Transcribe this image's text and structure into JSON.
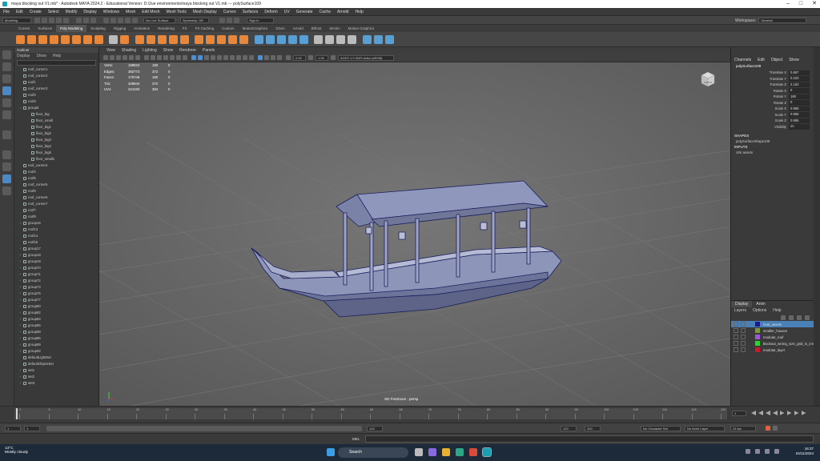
{
  "window": {
    "title": "maya blocking out V1.mb* - Autodesk MAYA 2024.2 - Educational Version: D:\\2ue environments\\maya blocking out V1.mb --- polySurface109"
  },
  "menubar": [
    "File",
    "Edit",
    "Create",
    "Select",
    "Modify",
    "Display",
    "Windows",
    "Mesh",
    "Edit Mesh",
    "Mesh Tools",
    "Mesh Display",
    "Curves",
    "Surfaces",
    "Deform",
    "UV",
    "Generate",
    "Cache",
    "Arnold",
    "Help"
  ],
  "workspace": {
    "label": "Workspace:",
    "value": "General"
  },
  "statusline": {
    "mode": "Modeling",
    "live_surface": "No Live Surface",
    "symmetry": "Symmetry: Off",
    "signin": "Sign In"
  },
  "shelf_tabs": [
    "Curves",
    "Surfaces",
    "Poly Modeling",
    "Sculpting",
    "Rigging",
    "Animation",
    "Rendering",
    "FX",
    "FX Caching",
    "Custom",
    "MotionGraphics",
    "XGen",
    "Arnold",
    "Bifrost",
    "MASH",
    "Motion Graphics"
  ],
  "shelf_active": "Poly Modeling",
  "outliner": {
    "title": "Outliner",
    "menu": [
      "Display",
      "Show",
      "Help"
    ],
    "items": [
      "roof_corner1",
      "roof_corner2",
      "roof1",
      "roof_corner3",
      "roof2",
      "roof3",
      "group5",
      "floor_big",
      "floor_small",
      "floor_big1",
      "floor_big2",
      "floor_big3",
      "floor_big4",
      "floor_big5",
      "floor_small1",
      "roof_corner4",
      "roof4",
      "roof5",
      "roof_corner5",
      "roof6",
      "roof_corner6",
      "roof_corner7",
      "roof7",
      "roof8",
      "group16",
      "roof13",
      "roof14",
      "roof15",
      "group17",
      "group18",
      "group19",
      "group70",
      "group71",
      "group72",
      "group74",
      "group75",
      "group77",
      "group80",
      "group82",
      "group84",
      "group85",
      "group88",
      "group86",
      "group89",
      "group92",
      "defaultLightSet",
      "defaultObjectSet",
      "set1",
      "set2",
      "set3"
    ]
  },
  "viewport_menu": [
    "View",
    "Shading",
    "Lighting",
    "Show",
    "Renderer",
    "Panels"
  ],
  "viewport_tools": {
    "field1": "0.00",
    "field2": "1.00",
    "colorspace": "ACES 1.0 SDR-video (sRGB)"
  },
  "hud": [
    {
      "label": "Verts:",
      "v1": "188923",
      "v2": "190",
      "v3": "0"
    },
    {
      "label": "Edges:",
      "v1": "392773",
      "v2": "372",
      "v3": "0"
    },
    {
      "label": "Faces:",
      "v1": "176746",
      "v2": "180",
      "v3": "0"
    },
    {
      "label": "Tris:",
      "v1": "348844",
      "v2": "372",
      "v3": "0"
    },
    {
      "label": "UVs:",
      "v1": "224183",
      "v2": "284",
      "v3": "0"
    }
  ],
  "camera_label": "SD PortZoom : persp",
  "viewcube_label": "FRONT",
  "channelbox": {
    "menu": [
      "Channels",
      "Edit",
      "Object",
      "Show"
    ],
    "object": "polySurface109",
    "attributes": [
      {
        "name": "Translate X",
        "value": "0.857"
      },
      {
        "name": "Translate Y",
        "value": "0.223"
      },
      {
        "name": "Translate Z",
        "value": "2.153"
      },
      {
        "name": "Rotate X",
        "value": "0"
      },
      {
        "name": "Rotate Y",
        "value": "180"
      },
      {
        "name": "Rotate Z",
        "value": "0"
      },
      {
        "name": "Scale X",
        "value": "0.955"
      },
      {
        "name": "Scale Y",
        "value": "0.955"
      },
      {
        "name": "Scale Z",
        "value": "0.955"
      },
      {
        "name": "Visibility",
        "value": "on"
      }
    ],
    "shapes_label": "SHAPES",
    "shape": "polySurfaceShape109",
    "inputs_label": "INPUTS",
    "input": "UNI assets"
  },
  "layers": {
    "tabs": [
      "Display",
      "Anim"
    ],
    "menu": [
      "Layers",
      "Options",
      "Help"
    ],
    "rows": [
      {
        "name": "boat_assets",
        "color": "#1a1a8c",
        "selected": true
      },
      {
        "name": "smaller_houses",
        "color": "#7a9a3a",
        "selected": false
      },
      {
        "name": "modular_roof",
        "color": "#9a5ad6",
        "selected": false
      },
      {
        "name": "blockout_wrong_size_grid_is_cm",
        "color": "#2ad62a",
        "selected": false
      },
      {
        "name": "modular_layer",
        "color": "#c81a2a",
        "selected": false
      }
    ]
  },
  "timeline": {
    "ticks": [
      "1",
      "5",
      "10",
      "15",
      "20",
      "25",
      "30",
      "35",
      "40",
      "45",
      "50",
      "55",
      "60",
      "65",
      "70",
      "75",
      "80",
      "85",
      "90",
      "95",
      "100",
      "105",
      "110",
      "115",
      "120"
    ],
    "current": "1"
  },
  "range": {
    "start": "1",
    "start2": "1",
    "end": "120",
    "end2": "120",
    "end3": "200",
    "character_set": "No Character Set",
    "anim_layer": "No Anim Layer",
    "fps": "24 fps"
  },
  "command": {
    "lang": "MEL"
  },
  "taskbar": {
    "temp": "13°C",
    "weather": "Mostly cloudy",
    "search": "Search",
    "time": "16:37",
    "date": "04/11/2024"
  }
}
